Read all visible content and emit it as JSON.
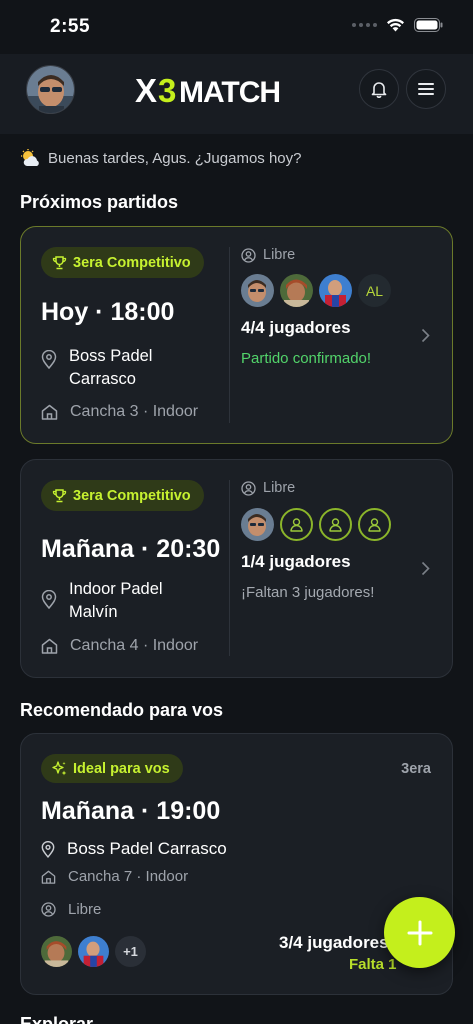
{
  "status_bar": {
    "time": "2:55"
  },
  "header": {
    "logo": "X3MATCH",
    "icons": [
      "avatar",
      "bell-icon",
      "menu-icon"
    ]
  },
  "greeting": {
    "icon": "sun-cloud-icon",
    "text": "Buenas tardes, Agus. ¿Jugamos hoy?"
  },
  "upcoming": {
    "title": "Próximos partidos",
    "matches": [
      {
        "badge": "3era Competitivo",
        "title": "Hoy · 18:00",
        "venue": "Boss Padel Carrasco",
        "court": "Cancha 3 · Indoor",
        "type": "Libre",
        "players_initials": "AL",
        "players": "4/4 jugadores",
        "status": "Partido confirmado!"
      },
      {
        "badge": "3era Competitivo",
        "title": "Mañana · 20:30",
        "venue": "Indoor Padel Malvín",
        "court": "Cancha 4 · Indoor",
        "type": "Libre",
        "players": "1/4 jugadores",
        "status": "¡Faltan 3 jugadores!"
      }
    ]
  },
  "recommended": {
    "title": "Recomendado para vos",
    "badge": "Ideal para vos",
    "level": "3era",
    "match_title": "Mañana · 19:00",
    "venue": "Boss Padel Carrasco",
    "court": "Cancha 7 · Indoor",
    "type": "Libre",
    "extra_players": "+1",
    "players": "3/4 jugadores",
    "missing": "Falta 1"
  },
  "next_section": {
    "title": "Explorar"
  },
  "colors": {
    "accent": "#c4ef1c",
    "confirmed": "#52d36a",
    "background": "#111418",
    "card": "#1b1f25"
  }
}
